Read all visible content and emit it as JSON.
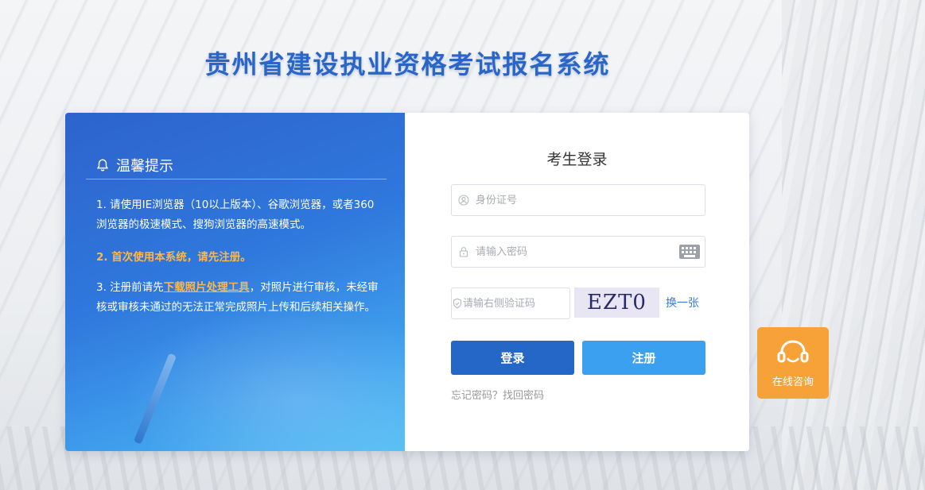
{
  "header": {
    "title": "贵州省建设执业资格考试报名系统"
  },
  "tips": {
    "heading": "温馨提示",
    "item1": "1. 请使用IE浏览器（10以上版本）、谷歌浏览器，或者360浏览器的极速模式、搜狗浏览器的高速模式。",
    "item2": "2. 首次使用本系统，请先注册。",
    "item3_prefix": "3. 注册前请先",
    "item3_link": "下载照片处理工具",
    "item3_suffix": "，对照片进行审核，未经审核或审核未通过的无法正常完成照片上传和后续相关操作。"
  },
  "login": {
    "title": "考生登录",
    "id_placeholder": "身份证号",
    "password_placeholder": "请输入密码",
    "captcha_placeholder": "请输右侧验证码",
    "captcha_text": "EZT0",
    "refresh_captcha": "换一张",
    "login_button": "登录",
    "register_button": "注册",
    "forgot_link": "忘记密码？找回密码"
  },
  "consult": {
    "label": "在线咨询",
    "icon": "headset-icon"
  },
  "colors": {
    "primary": "#2567c7",
    "secondary": "#3aa0ef",
    "accent": "#f7a238",
    "title": "#2a66c8"
  }
}
